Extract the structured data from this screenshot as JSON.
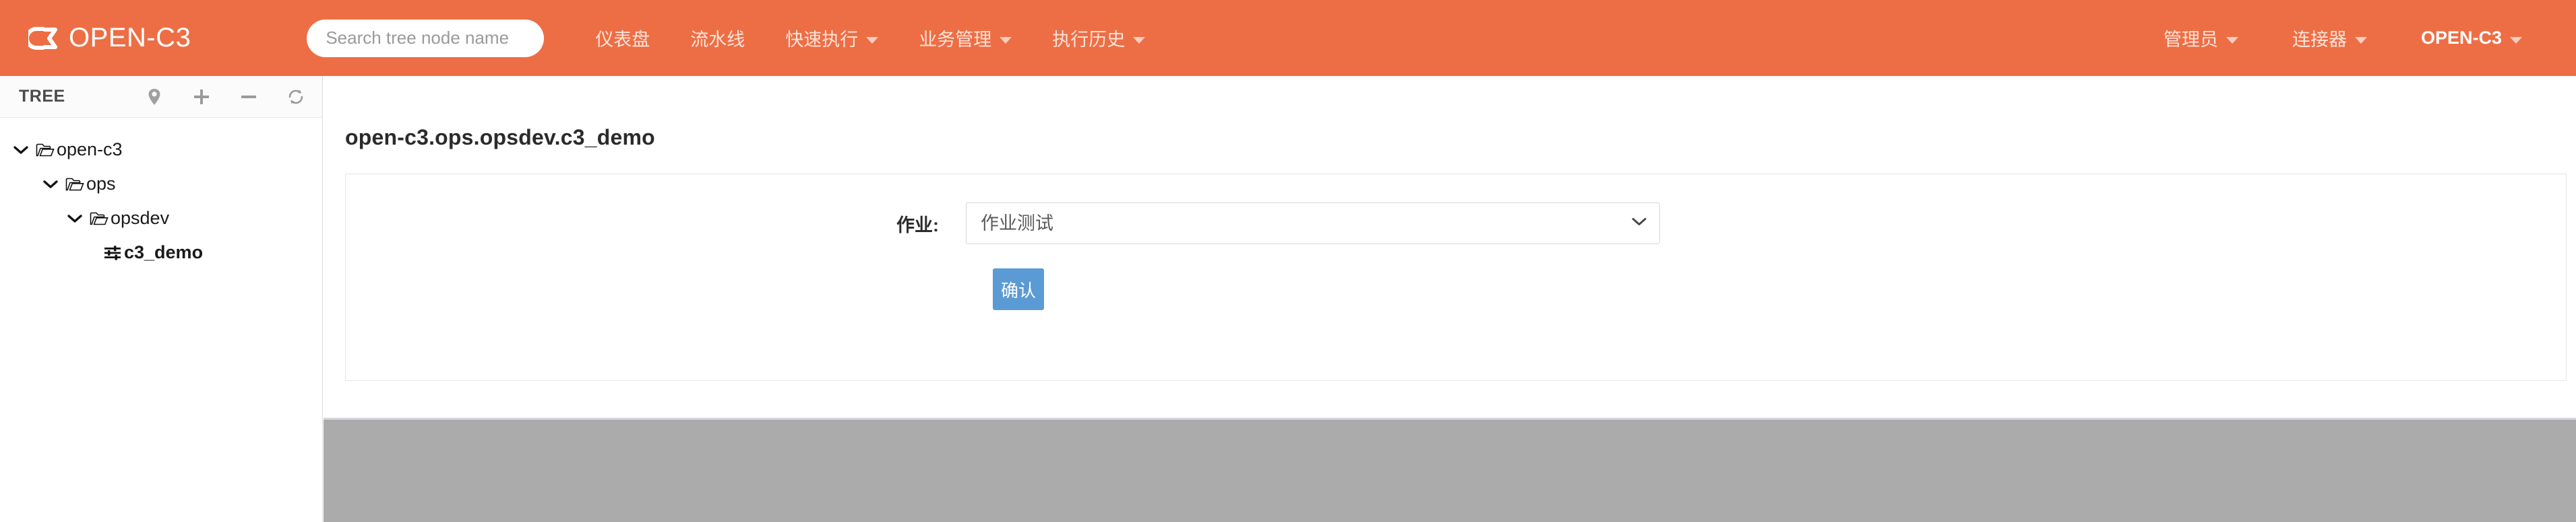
{
  "navbar": {
    "brand": {
      "logo_icon": "c3-logo-icon",
      "label": "OPEN-C3"
    },
    "search": {
      "placeholder": "Search tree node name",
      "value": ""
    },
    "links": [
      {
        "label": "仪表盘",
        "has_caret": false
      },
      {
        "label": "流水线",
        "has_caret": false
      },
      {
        "label": "快速执行",
        "has_caret": true
      },
      {
        "label": "业务管理",
        "has_caret": true
      },
      {
        "label": "执行历史",
        "has_caret": true
      }
    ],
    "right_links": [
      {
        "label": "管理员",
        "has_caret": true
      },
      {
        "label": "连接器",
        "has_caret": true
      },
      {
        "label": "OPEN-C3",
        "has_caret": true
      }
    ],
    "background_color": "#ed6e45"
  },
  "sidebar": {
    "header": {
      "title": "TREE",
      "tools": [
        {
          "icon": "location-pin-icon",
          "name": "locate-node-button"
        },
        {
          "icon": "plus-icon",
          "name": "add-node-button"
        },
        {
          "icon": "minus-icon",
          "name": "remove-node-button"
        },
        {
          "icon": "refresh-icon",
          "name": "refresh-tree-button"
        }
      ]
    },
    "tree": [
      {
        "label": "open-c3",
        "depth": 0,
        "icon": "folder-icon",
        "expanded": true,
        "selected": false
      },
      {
        "label": "ops",
        "depth": 1,
        "icon": "folder-icon",
        "expanded": true,
        "selected": false
      },
      {
        "label": "opsdev",
        "depth": 2,
        "icon": "folder-icon",
        "expanded": true,
        "selected": false
      },
      {
        "label": "c3_demo",
        "depth": 3,
        "icon": "sliders-icon",
        "expanded": false,
        "selected": true
      }
    ]
  },
  "main": {
    "page_title": "open-c3.ops.opsdev.c3_demo",
    "form": {
      "job_label": "作业:",
      "job_selected": "作业测试",
      "job_options": [
        "作业测试"
      ],
      "confirm_label": "确认",
      "confirm_color": "#5b9bd5"
    }
  },
  "gray_panel": {
    "color": "#ababab"
  }
}
